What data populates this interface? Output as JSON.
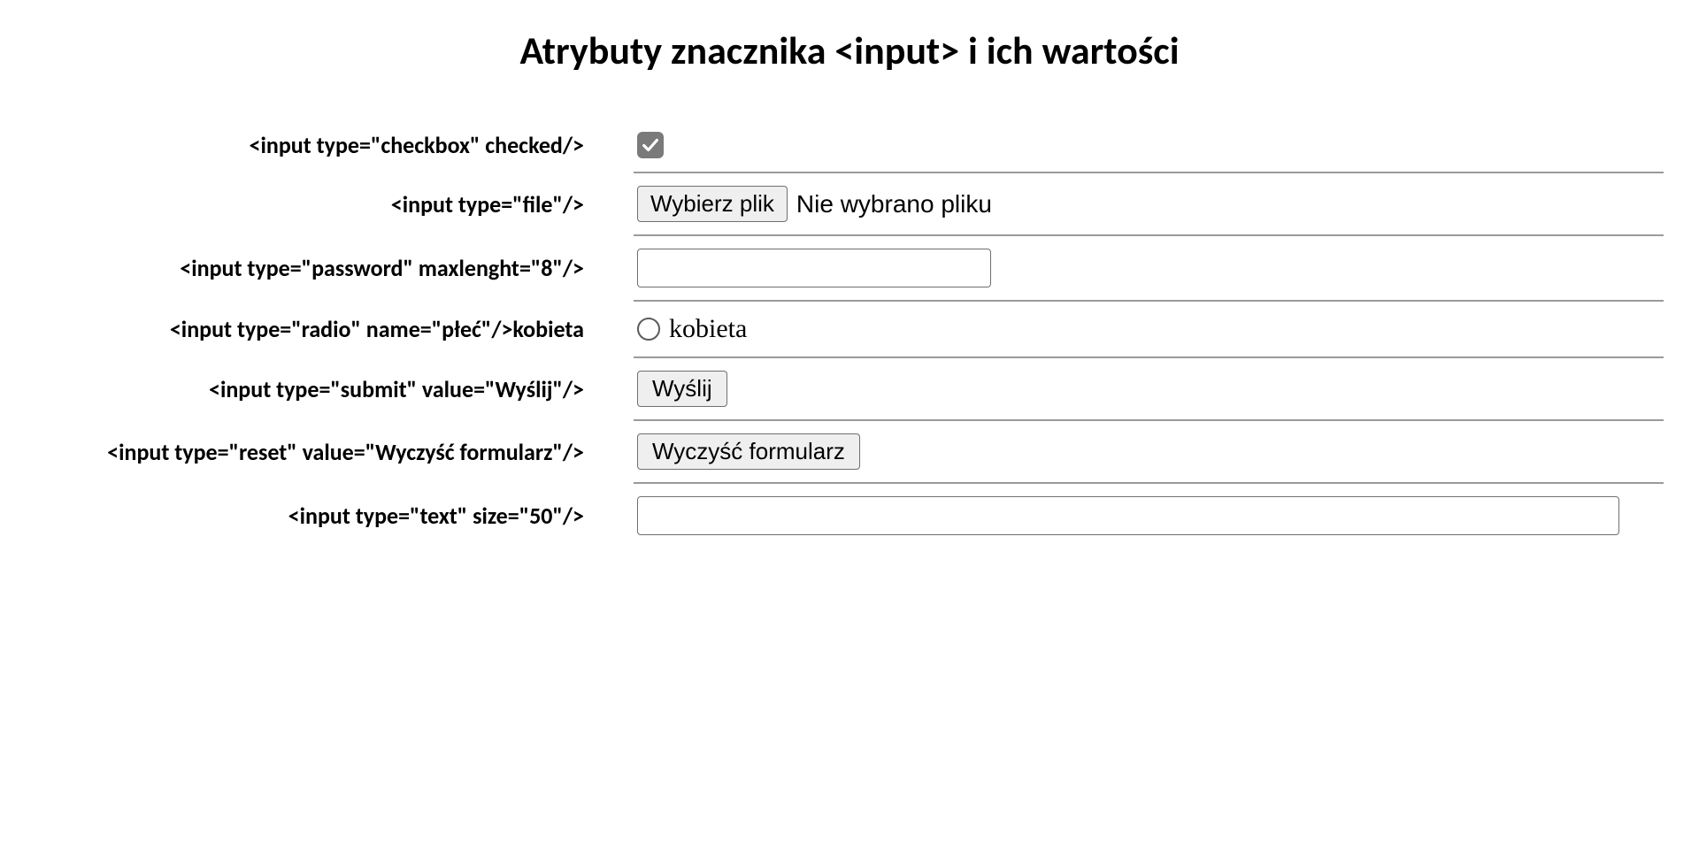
{
  "title": "Atrybuty znacznika <input> i ich wartości",
  "rows": {
    "checkbox": {
      "label": "<input type=\"checkbox\" checked/>"
    },
    "file": {
      "label": "<input type=\"file\"/>",
      "button": "Wybierz plik",
      "status": "Nie wybrano pliku"
    },
    "password": {
      "label": "<input type=\"password\" maxlenght=\"8\"/>",
      "value": ""
    },
    "radio": {
      "label": "<input type=\"radio\" name=\"płeć\"/>kobieta",
      "option": "kobieta"
    },
    "submit": {
      "label": "<input type=\"submit\" value=\"Wyślij\"/>",
      "button": "Wyślij"
    },
    "reset": {
      "label": "<input type=\"reset\" value=\"Wyczyść formularz\"/>",
      "button": "Wyczyść formularz"
    },
    "text": {
      "label": "<input type=\"text\" size=\"50\"/>",
      "value": ""
    }
  }
}
